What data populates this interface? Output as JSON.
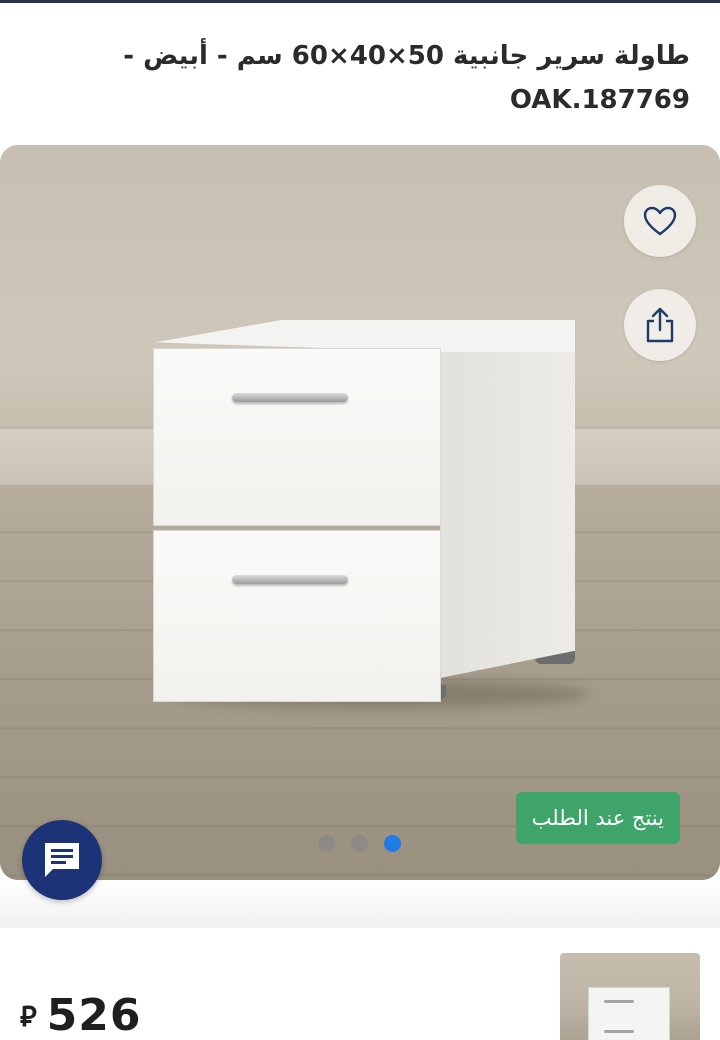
{
  "product": {
    "title_line1": "طاولة سرير جانبية 50×40×60 سم - أبيض -",
    "title_line2": "OAK.187769"
  },
  "gallery": {
    "badge_text": "ينتج عند الطلب",
    "dots_count": 3,
    "active_dot": 3,
    "icons": {
      "favorite": "heart-icon",
      "share": "share-icon",
      "chat": "chat-icon"
    }
  },
  "pricing": {
    "price": "526",
    "currency_symbol": "⃁"
  },
  "colors": {
    "badge_green": "#3fa46a",
    "active_dot": "#1f7be6",
    "chat_button": "#1d3378"
  }
}
